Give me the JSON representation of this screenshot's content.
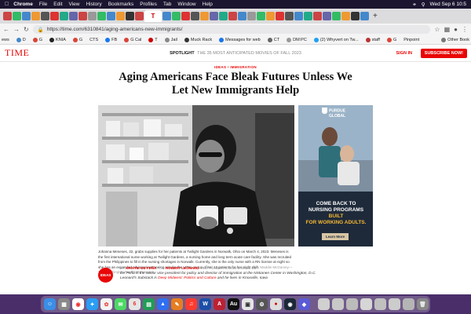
{
  "menubar": {
    "app": "Chrome",
    "items": [
      "File",
      "Edit",
      "View",
      "History",
      "Bookmarks",
      "Profiles",
      "Tab",
      "Window",
      "Help"
    ],
    "clock": "Wed Sep 6 10:5"
  },
  "browser": {
    "active_tab_icon": "T",
    "url": "https://time.com/6310841/aging-americans-new-immigrants/",
    "bookmarks": [
      "ews",
      "D",
      "G",
      "KNIA",
      "G",
      "CTS",
      "FB",
      "G Cal",
      "T",
      "Jail",
      "Muck Rack",
      "Messages for web",
      "CT",
      "DM:PC",
      "(2) Whyvert on Tw...",
      "staff",
      "G",
      "Pinpoint"
    ],
    "other_bookmarks": "Other Book"
  },
  "site": {
    "logo": "TIME",
    "spotlight_label": "SPOTLIGHT",
    "spotlight_text": "THE 35 MOST ANTICIPATED MOVIES OF FALL 2023",
    "sign_in": "SIGN IN",
    "subscribe": "SUBSCRIBE NOW!"
  },
  "article": {
    "eyebrow": "IDEAS • IMMIGRATION",
    "headline": "Aging Americans Face Bleak Futures Unless We Let New Immigrants Help",
    "caption": "Johanna Meneses, 32, grabs supplies for her patients at Twilight Gardens in Norwalk, Ohio on March 4, 2023. Meneses is the first international nurse working at Twilight Gardens, a nursing home and long term acute care facility. She was recruited from the Philippines to fill in the nursing shortages in Norwalk. Currently, she is the only nurse with a RN license at night so she has an expanded advisory/overseeing role for the LPNs on top of her 16 patients for her night shift.",
    "photo_credit": "Maddie McGarvey—The Washington Post/Getty Images",
    "ideas_badge": "IDEAS",
    "byline_prefix": "BY",
    "author1": "KRISTIE DE PEÑA",
    "byline_and": "AND",
    "author2": "ROBERT LEONARD",
    "date": "SEPTEMBER 6, 2023 6:00 AM EDT",
    "bio1": "De Peña is the senior vice president for policy and director of immigration at the Niskanen Center in Washington, D.C.",
    "bio2_prefix": "Leonard's Substack is",
    "bio2_link": "Deep Midwest: Politics and Culture",
    "bio2_suffix": "and he lives in Knoxville, Iowa"
  },
  "ad": {
    "brand_line1": "PURDUE",
    "brand_line2": "GLOBAL",
    "headline_line1": "COME BACK TO",
    "headline_line2": "NURSING PROGRAMS",
    "headline_line2b": "BUILT",
    "headline_line3": "FOR WORKING ADULTS.",
    "cta": "Learn More"
  }
}
